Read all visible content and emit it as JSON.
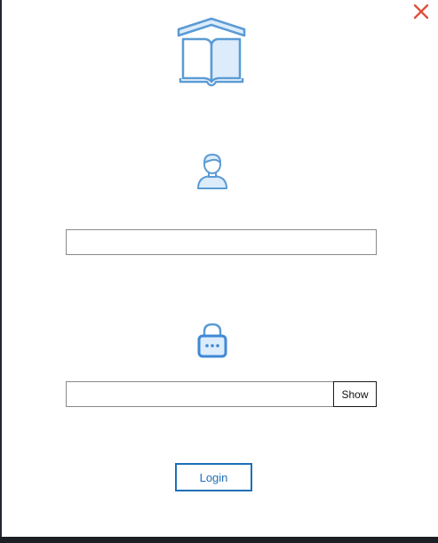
{
  "window": {
    "close_icon": "close-icon"
  },
  "logo": {
    "icon": "book-house-icon",
    "accent_color": "#5b9bd5",
    "fill_color": "#dcecfb"
  },
  "username": {
    "icon": "user-icon",
    "value": "",
    "placeholder": ""
  },
  "password": {
    "icon": "lock-icon",
    "value": "",
    "placeholder": "",
    "show_label": "Show"
  },
  "login": {
    "label": "Login",
    "color": "#1f6fb8"
  },
  "colors": {
    "close": "#e0503c",
    "icon_blue": "#5b9bd5",
    "icon_fill": "#dcecfb"
  }
}
